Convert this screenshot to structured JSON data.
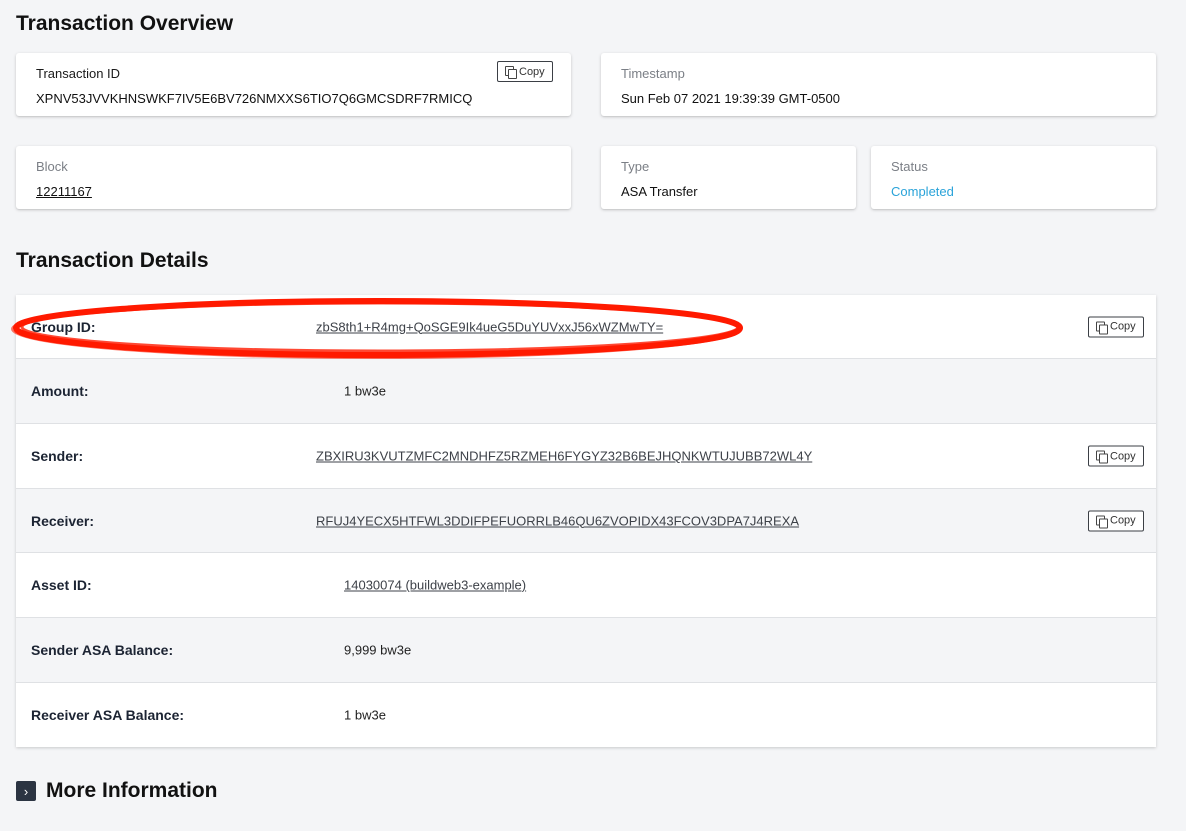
{
  "overview": {
    "title": "Transaction Overview",
    "transaction_id": {
      "label": "Transaction ID",
      "value": "XPNV53JVVKHNSWKF7IV5E6BV726NMXXS6TIO7Q6GMCSDRF7RMICQ",
      "copy_label": "Copy"
    },
    "timestamp": {
      "label": "Timestamp",
      "value": "Sun Feb 07 2021 19:39:39 GMT-0500"
    },
    "block": {
      "label": "Block",
      "value": "12211167"
    },
    "type": {
      "label": "Type",
      "value": "ASA Transfer"
    },
    "status": {
      "label": "Status",
      "value": "Completed"
    }
  },
  "details": {
    "title": "Transaction Details",
    "rows": [
      {
        "label": "Group ID:",
        "value": "zbS8th1+R4mg+QoSGE9Ik4ueG5DuYUVxxJ56xWZMwTY=",
        "copy_label": "Copy"
      },
      {
        "label": "Amount:",
        "value": "1 bw3e"
      },
      {
        "label": "Sender:",
        "value": "ZBXIRU3KVUTZMFC2MNDHFZ5RZMEH6FYGYZ32B6BEJHQNKWTUJUBB72WL4Y",
        "copy_label": "Copy"
      },
      {
        "label": "Receiver:",
        "value": "RFUJ4YECX5HTFWL3DDIFPEFUORRLB46QU6ZVOPIDX43FCOV3DPA7J4REXA",
        "copy_label": "Copy"
      },
      {
        "label": "Asset ID:",
        "value": "14030074 (buildweb3-example)"
      },
      {
        "label": "Sender ASA Balance:",
        "value": "9,999 bw3e"
      },
      {
        "label": "Receiver ASA Balance:",
        "value": "1 bw3e"
      }
    ]
  },
  "more_information": {
    "label": "More Information",
    "toggle_glyph": "›"
  },
  "colors": {
    "status": "#2aa3d9",
    "annotation": "#ff1a00",
    "background": "#f4f5f7"
  }
}
